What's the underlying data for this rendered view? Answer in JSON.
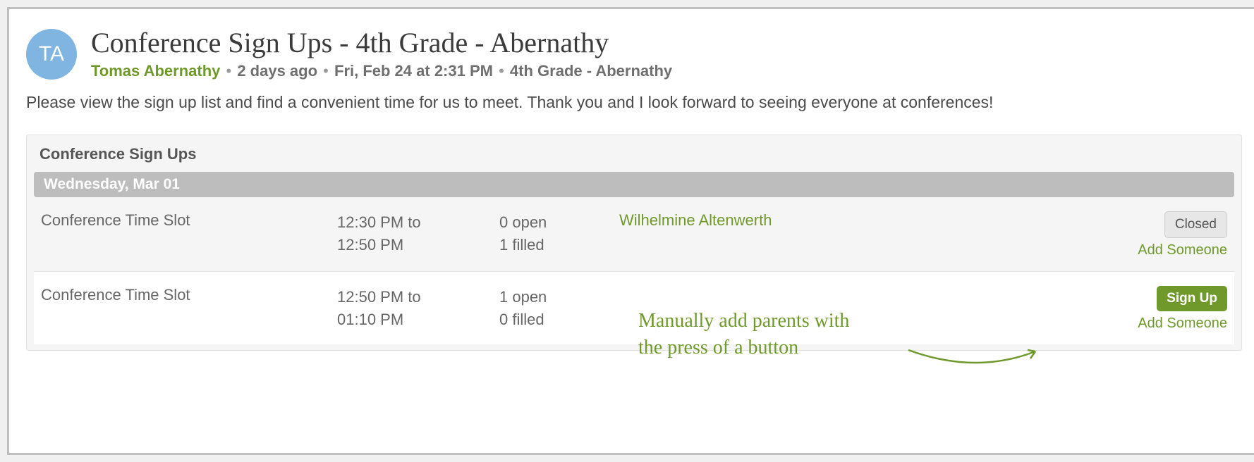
{
  "post": {
    "avatar_initials": "TA",
    "title": "Conference Sign Ups - 4th Grade - Abernathy",
    "author": "Tomas Abernathy",
    "age": "2 days ago",
    "datetime": "Fri, Feb 24 at 2:31 PM",
    "group": "4th Grade - Abernathy",
    "intro": "Please view the sign up list and find a convenient time for us to meet. Thank you and I look forward to seeing everyone at conferences!"
  },
  "panel": {
    "title": "Conference Sign Ups",
    "date": "Wednesday, Mar 01",
    "slots": [
      {
        "name": "Conference Time Slot",
        "time_line1": "12:30 PM to",
        "time_line2": "12:50 PM",
        "open": "0 open",
        "filled": "1 filled",
        "person": "Wilhelmine Altenwerth",
        "action_label": "Closed",
        "action_type": "closed",
        "add_label": "Add Someone"
      },
      {
        "name": "Conference Time Slot",
        "time_line1": "12:50 PM to",
        "time_line2": "01:10 PM",
        "open": "1 open",
        "filled": "0 filled",
        "person": "",
        "action_label": "Sign Up",
        "action_type": "signup",
        "add_label": "Add Someone"
      }
    ]
  },
  "annotation": {
    "line1": "Manually add parents with",
    "line2": "the press of a button"
  }
}
